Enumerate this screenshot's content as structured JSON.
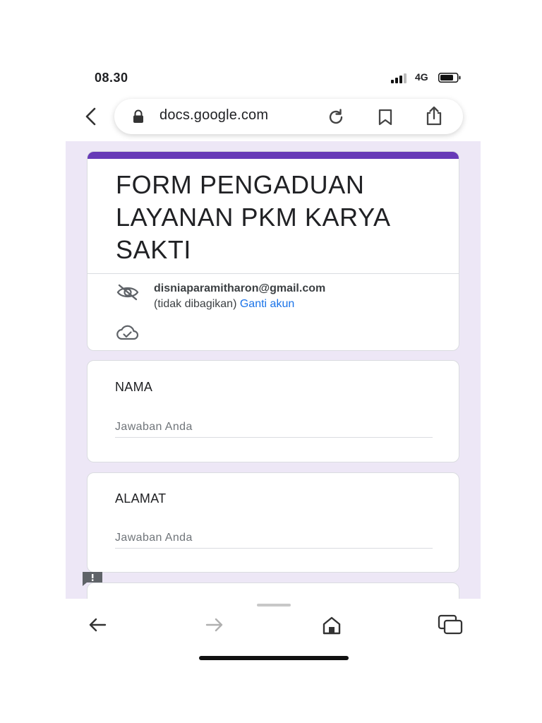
{
  "status_bar": {
    "time": "08.30",
    "network": "4G"
  },
  "browser": {
    "url": "docs.google.com"
  },
  "form": {
    "title": "FORM PENGADUAN LAYANAN PKM KARYA SAKTI",
    "accent_color": "#673ab7",
    "background_color": "#ede7f6",
    "account": {
      "email": "disniaparamitharon@gmail.com",
      "not_shared": "(tidak dibagikan)",
      "switch_account": "Ganti akun"
    },
    "questions": [
      {
        "label": "NAMA",
        "placeholder": "Jawaban Anda"
      },
      {
        "label": "ALAMAT",
        "placeholder": "Jawaban Anda"
      }
    ]
  },
  "icons": {
    "back": "chevron-left-icon",
    "lock": "lock-icon",
    "reload": "reload-icon",
    "bookmark": "bookmark-icon",
    "share": "share-icon",
    "hidden": "eye-off-icon",
    "cloud": "cloud-check-icon",
    "feedback": "feedback-icon",
    "nav_back": "arrow-left-icon",
    "nav_forward": "arrow-right-icon",
    "home": "home-icon",
    "tabs": "tabs-icon"
  },
  "link_color": "#1a73e8"
}
